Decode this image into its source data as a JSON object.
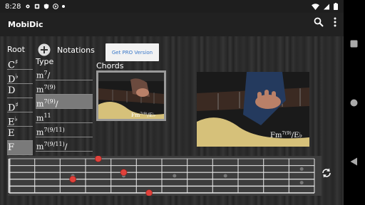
{
  "status_bar": {
    "time": "8:28"
  },
  "app": {
    "title": "MobiDic"
  },
  "root_column": {
    "header": "Root",
    "items": [
      {
        "base": "C",
        "acc": "♯",
        "selected": false
      },
      {
        "base": "D",
        "acc": "♭",
        "selected": false
      },
      {
        "base": "D",
        "acc": "",
        "selected": false
      },
      {
        "base": "D",
        "acc": "♯",
        "selected": false
      },
      {
        "base": "E",
        "acc": "♭",
        "selected": false
      },
      {
        "base": "E",
        "acc": "",
        "selected": false
      },
      {
        "base": "F",
        "acc": "",
        "selected": true
      }
    ]
  },
  "notations_label": "Notations",
  "type_column": {
    "header": "Type",
    "items": [
      {
        "base": "m",
        "sup": "7",
        "tail": "/",
        "selected": false
      },
      {
        "base": "m",
        "sup": "7(9)",
        "tail": "",
        "selected": false
      },
      {
        "base": "m",
        "sup": "7(9)",
        "tail": "/",
        "selected": true
      },
      {
        "base": "m",
        "sup": "11",
        "tail": "",
        "selected": false
      },
      {
        "base": "m",
        "sup": "7(9/11)",
        "tail": "",
        "selected": false
      },
      {
        "base": "m",
        "sup": "7(9/11)",
        "tail": "/",
        "selected": false
      }
    ]
  },
  "go_pro_label": "Get PRO Version",
  "chords_label": "Chords",
  "chord_photos": [
    {
      "root": "Fm",
      "sup": "7(9)",
      "bass": "/E♭"
    },
    {
      "root": "Fm",
      "sup": "7(9)",
      "bass": "/E♭"
    }
  ],
  "fretboard": {
    "strings": 6,
    "frets": 12,
    "inlays": [
      3,
      5,
      7,
      9
    ],
    "double_inlay": 12,
    "finger_positions": [
      {
        "string": 1,
        "fret": 4
      },
      {
        "string": 3,
        "fret": 5
      },
      {
        "string": 4,
        "fret": 3
      },
      {
        "string": 6,
        "fret": 6
      }
    ],
    "dot_color": "#e0413b"
  },
  "colors": {
    "accent": "#3a78c9",
    "selected_row": "#7a7a7a",
    "dot": "#e0413b"
  }
}
